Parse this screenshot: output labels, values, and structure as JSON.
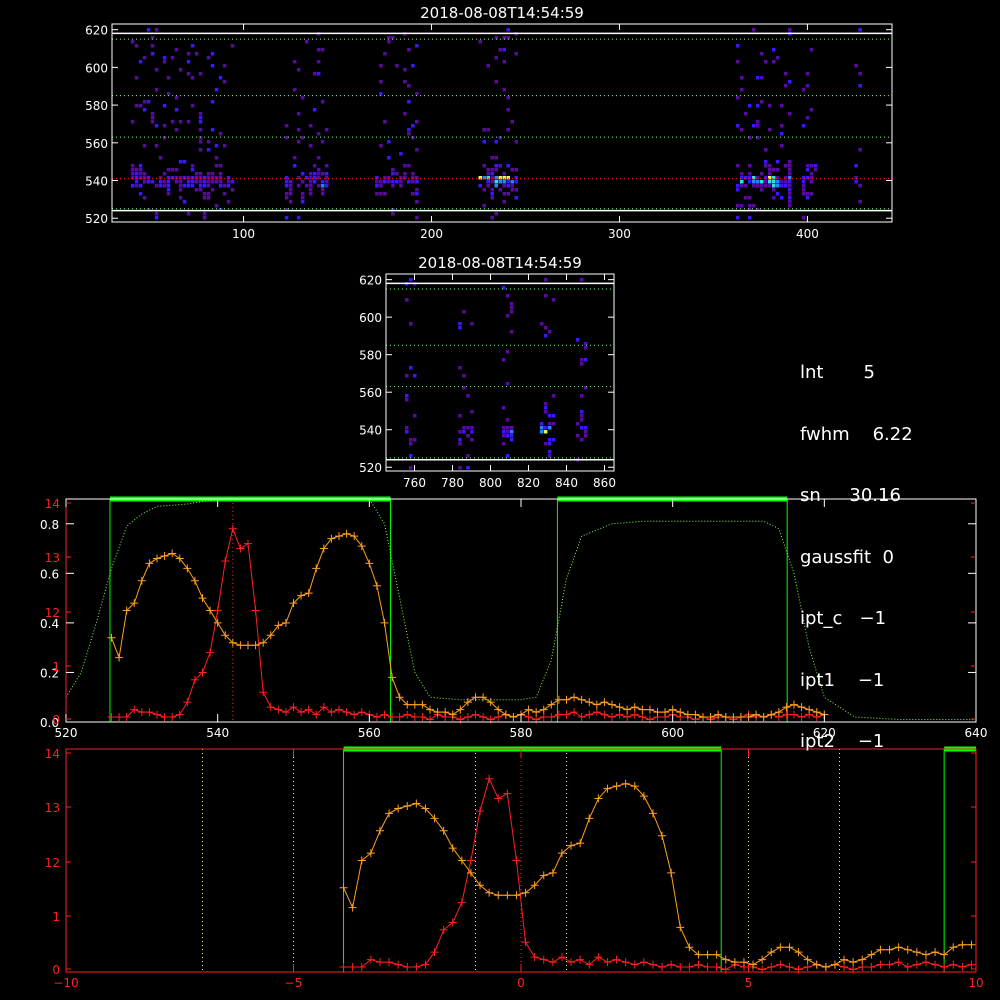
{
  "chart_data": [
    {
      "type": "heatmap",
      "title": "2018-08-08T14:54:59",
      "x_ticks": [
        "100",
        "200",
        "300",
        "400"
      ],
      "y_ticks": [
        "520",
        "540",
        "560",
        "580",
        "600",
        "620"
      ],
      "x_range": [
        30,
        445
      ],
      "y_range": [
        518,
        623
      ],
      "bright_band_y": 541,
      "dotted_lines_y": [
        525,
        541,
        563,
        585,
        615
      ],
      "solid_lines_y": [
        524,
        618
      ],
      "columns": [
        {
          "x": [
            40,
            95
          ],
          "level": 0.55
        },
        {
          "x": [
            122,
            145
          ],
          "level": 0.6
        },
        {
          "x": [
            170,
            193
          ],
          "level": 0.5
        },
        {
          "x": [
            225,
            245
          ],
          "level": 1.0
        },
        {
          "x": [
            362,
            390
          ],
          "level": 0.85
        },
        {
          "x": [
            397,
            405
          ],
          "level": 0.6
        },
        {
          "x": [
            425,
            428
          ],
          "level": 0.4
        }
      ]
    },
    {
      "type": "heatmap",
      "title": "2018-08-08T14:54:59",
      "x_ticks": [
        "760",
        "780",
        "800",
        "820",
        "840",
        "860"
      ],
      "y_ticks": [
        "520",
        "540",
        "560",
        "580",
        "600",
        "620"
      ],
      "x_range": [
        745,
        865
      ],
      "y_range": [
        518,
        623
      ],
      "dotted_lines_y": [
        525,
        563,
        585,
        615
      ],
      "solid_lines_y": [
        524,
        618
      ],
      "columns": [
        {
          "x": [
            755,
            760
          ],
          "level": 0.5
        },
        {
          "x": [
            783,
            790
          ],
          "level": 0.45
        },
        {
          "x": [
            806,
            812
          ],
          "level": 0.6
        },
        {
          "x": [
            826,
            834
          ],
          "level": 1.0
        },
        {
          "x": [
            845,
            850
          ],
          "level": 0.4
        }
      ]
    },
    {
      "type": "line",
      "x_ticks": [
        "520",
        "540",
        "560",
        "580",
        "600",
        "620",
        "640"
      ],
      "y_ticks_left": [
        "0.0",
        "0.2",
        "0.4",
        "0.6",
        "0.8"
      ],
      "y_ticks_red": [
        "0",
        "1",
        "12",
        "13",
        "14"
      ],
      "xlim": [
        520,
        640
      ],
      "ylim": [
        0,
        0.9
      ],
      "marker_line_x": 542,
      "green_bars": [
        [
          525.8,
          562.8
        ],
        [
          584.8,
          615.1
        ]
      ],
      "series": [
        {
          "color": "#ff2020",
          "x": [
            526,
            527,
            528,
            529,
            530,
            531,
            532,
            533,
            534,
            535,
            536,
            537,
            538,
            539,
            540,
            541,
            542,
            543,
            544,
            545,
            546,
            547,
            548,
            549,
            550,
            551,
            552,
            553,
            554,
            555,
            556,
            557,
            558,
            559,
            560,
            561,
            562,
            563,
            564,
            565,
            566,
            567,
            568,
            569,
            570,
            571,
            572,
            573,
            574,
            575,
            576,
            577,
            578,
            579,
            580,
            581,
            582,
            583,
            584,
            585,
            586,
            587,
            588,
            589,
            590,
            591,
            592,
            593,
            594,
            595,
            596,
            597,
            598,
            599,
            600,
            601,
            602,
            603,
            604,
            605,
            606,
            607,
            608,
            609,
            610,
            611,
            612,
            613,
            614,
            615,
            616,
            617,
            618,
            619,
            620
          ],
          "y": [
            0.02,
            0.02,
            0.02,
            0.05,
            0.04,
            0.04,
            0.03,
            0.02,
            0.02,
            0.03,
            0.08,
            0.17,
            0.2,
            0.28,
            0.45,
            0.65,
            0.78,
            0.7,
            0.72,
            0.45,
            0.12,
            0.06,
            0.05,
            0.04,
            0.06,
            0.04,
            0.05,
            0.03,
            0.06,
            0.04,
            0.05,
            0.04,
            0.03,
            0.04,
            0.03,
            0.02,
            0.03,
            0.02,
            0.02,
            0.03,
            0.02,
            0.02,
            0.01,
            0.03,
            0.02,
            0.02,
            0.01,
            0.02,
            0.03,
            0.02,
            0.01,
            0.02,
            0.03,
            0.02,
            0.03,
            0.02,
            0.01,
            0.02,
            0.02,
            0.03,
            0.03,
            0.04,
            0.02,
            0.03,
            0.04,
            0.03,
            0.02,
            0.03,
            0.02,
            0.03,
            0.02,
            0.01,
            0.02,
            0.02,
            0.03,
            0.02,
            0.02,
            0.01,
            0.02,
            0.01,
            0.02,
            0.02,
            0.01,
            0.02,
            0.03,
            0.02,
            0.02,
            0.03,
            0.02,
            0.03,
            0.03,
            0.02,
            0.03,
            0.02,
            0.03
          ]
        },
        {
          "color": "#ffa020",
          "x": [
            526,
            527,
            528,
            529,
            530,
            531,
            532,
            533,
            534,
            535,
            536,
            537,
            538,
            539,
            540,
            541,
            542,
            543,
            544,
            545,
            546,
            547,
            548,
            549,
            550,
            551,
            552,
            553,
            554,
            555,
            556,
            557,
            558,
            559,
            560,
            561,
            562,
            563,
            564,
            565,
            566,
            567,
            568,
            569,
            570,
            571,
            572,
            573,
            574,
            575,
            576,
            577,
            578,
            579,
            580,
            581,
            582,
            583,
            584,
            585,
            586,
            587,
            588,
            589,
            590,
            591,
            592,
            593,
            594,
            595,
            596,
            597,
            598,
            599,
            600,
            601,
            602,
            603,
            604,
            605,
            606,
            607,
            608,
            609,
            610,
            611,
            612,
            613,
            614,
            615,
            616,
            617,
            618,
            619,
            620
          ],
          "y": [
            0.34,
            0.26,
            0.45,
            0.48,
            0.57,
            0.64,
            0.66,
            0.67,
            0.68,
            0.66,
            0.62,
            0.57,
            0.5,
            0.45,
            0.4,
            0.35,
            0.32,
            0.31,
            0.31,
            0.31,
            0.32,
            0.35,
            0.39,
            0.4,
            0.48,
            0.51,
            0.52,
            0.62,
            0.7,
            0.74,
            0.75,
            0.76,
            0.75,
            0.71,
            0.64,
            0.55,
            0.4,
            0.18,
            0.1,
            0.07,
            0.07,
            0.07,
            0.05,
            0.04,
            0.04,
            0.03,
            0.05,
            0.08,
            0.1,
            0.1,
            0.08,
            0.05,
            0.03,
            0.02,
            0.03,
            0.05,
            0.04,
            0.05,
            0.07,
            0.09,
            0.09,
            0.1,
            0.09,
            0.08,
            0.07,
            0.08,
            0.07,
            0.06,
            0.05,
            0.06,
            0.05,
            0.05,
            0.04,
            0.04,
            0.05,
            0.04,
            0.03,
            0.03,
            0.02,
            0.02,
            0.03,
            0.02,
            0.02,
            0.02,
            0.02,
            0.03,
            0.02,
            0.03,
            0.04,
            0.06,
            0.07,
            0.06,
            0.05,
            0.04,
            0.03
          ]
        },
        {
          "color": "#80ff40",
          "dotted": true,
          "x": [
            520,
            522,
            524,
            526,
            528,
            530,
            532,
            536,
            540,
            544,
            548,
            552,
            556,
            560,
            562,
            564,
            566,
            568,
            572,
            576,
            580,
            582,
            584,
            586,
            588,
            592,
            596,
            600,
            604,
            608,
            612,
            614,
            616,
            618,
            620,
            624,
            630,
            636,
            640
          ],
          "y": [
            0.1,
            0.2,
            0.4,
            0.62,
            0.79,
            0.84,
            0.87,
            0.88,
            0.9,
            0.91,
            0.9,
            0.91,
            0.91,
            0.9,
            0.8,
            0.5,
            0.2,
            0.1,
            0.09,
            0.09,
            0.09,
            0.1,
            0.25,
            0.58,
            0.75,
            0.8,
            0.81,
            0.81,
            0.81,
            0.81,
            0.81,
            0.78,
            0.6,
            0.3,
            0.1,
            0.02,
            0.01,
            0.01,
            0.01
          ]
        }
      ]
    },
    {
      "type": "line",
      "x_ticks": [
        "−10",
        "−5",
        "0",
        "5",
        "10"
      ],
      "y_ticks_red": [
        "0",
        "1",
        "12",
        "13",
        "14"
      ],
      "xlim": [
        -10,
        10
      ],
      "ylim": [
        0,
        0.9
      ],
      "marker_line_x": 0,
      "dotted_lines_x": [
        -7,
        -5,
        -1,
        1,
        5,
        7
      ],
      "green_bars": [
        [
          -3.9,
          4.4
        ],
        [
          9.3,
          10
        ]
      ],
      "series": [
        {
          "color": "#ff2020",
          "x": [
            -3.9,
            -3.7,
            -3.5,
            -3.3,
            -3.1,
            -2.9,
            -2.7,
            -2.5,
            -2.3,
            -2.1,
            -1.9,
            -1.7,
            -1.5,
            -1.3,
            -1.1,
            -0.9,
            -0.7,
            -0.5,
            -0.3,
            -0.1,
            0.1,
            0.3,
            0.5,
            0.7,
            0.9,
            1.1,
            1.3,
            1.5,
            1.7,
            1.9,
            2.1,
            2.3,
            2.5,
            2.7,
            2.9,
            3.1,
            3.3,
            3.5,
            3.7,
            3.9,
            4.1,
            4.3,
            4.5,
            4.7,
            4.9,
            5.1,
            5.3,
            5.5,
            5.7,
            5.9,
            6.1,
            6.3,
            6.5,
            6.7,
            6.9,
            7.1,
            7.3,
            7.5,
            7.7,
            7.9,
            8.1,
            8.3,
            8.5,
            8.7,
            8.9,
            9.1,
            9.3,
            9.5,
            9.7,
            9.9
          ],
          "y": [
            0.02,
            0.02,
            0.02,
            0.05,
            0.04,
            0.04,
            0.03,
            0.02,
            0.02,
            0.03,
            0.08,
            0.17,
            0.2,
            0.28,
            0.45,
            0.65,
            0.78,
            0.7,
            0.72,
            0.45,
            0.12,
            0.06,
            0.05,
            0.04,
            0.06,
            0.04,
            0.05,
            0.03,
            0.06,
            0.04,
            0.05,
            0.04,
            0.03,
            0.04,
            0.03,
            0.02,
            0.03,
            0.02,
            0.02,
            0.03,
            0.02,
            0.02,
            0.01,
            0.03,
            0.02,
            0.02,
            0.01,
            0.02,
            0.03,
            0.02,
            0.01,
            0.02,
            0.03,
            0.02,
            0.03,
            0.02,
            0.01,
            0.02,
            0.02,
            0.03,
            0.03,
            0.04,
            0.02,
            0.03,
            0.04,
            0.03,
            0.02,
            0.03,
            0.02,
            0.03
          ]
        },
        {
          "color": "#ffa020",
          "x": [
            -3.9,
            -3.7,
            -3.5,
            -3.3,
            -3.1,
            -2.9,
            -2.7,
            -2.5,
            -2.3,
            -2.1,
            -1.9,
            -1.7,
            -1.5,
            -1.3,
            -1.1,
            -0.9,
            -0.7,
            -0.5,
            -0.3,
            -0.1,
            0.1,
            0.3,
            0.5,
            0.7,
            0.9,
            1.1,
            1.3,
            1.5,
            1.7,
            1.9,
            2.1,
            2.3,
            2.5,
            2.7,
            2.9,
            3.1,
            3.3,
            3.5,
            3.7,
            3.9,
            4.1,
            4.3,
            4.5,
            4.7,
            4.9,
            5.1,
            5.3,
            5.5,
            5.7,
            5.9,
            6.1,
            6.3,
            6.5,
            6.7,
            6.9,
            7.1,
            7.3,
            7.5,
            7.7,
            7.9,
            8.1,
            8.3,
            8.5,
            8.7,
            8.9,
            9.1,
            9.3,
            9.5,
            9.7,
            9.9
          ],
          "y": [
            0.34,
            0.26,
            0.45,
            0.48,
            0.57,
            0.64,
            0.66,
            0.67,
            0.68,
            0.66,
            0.62,
            0.57,
            0.5,
            0.45,
            0.4,
            0.35,
            0.32,
            0.31,
            0.31,
            0.31,
            0.32,
            0.35,
            0.39,
            0.4,
            0.48,
            0.51,
            0.52,
            0.62,
            0.7,
            0.74,
            0.75,
            0.76,
            0.75,
            0.71,
            0.64,
            0.55,
            0.4,
            0.18,
            0.1,
            0.07,
            0.07,
            0.07,
            0.05,
            0.04,
            0.04,
            0.03,
            0.05,
            0.08,
            0.1,
            0.1,
            0.08,
            0.05,
            0.03,
            0.02,
            0.03,
            0.05,
            0.04,
            0.05,
            0.07,
            0.09,
            0.09,
            0.1,
            0.09,
            0.08,
            0.07,
            0.08,
            0.07,
            0.1,
            0.11,
            0.11
          ]
        }
      ]
    }
  ],
  "info": {
    "lines": [
      "lnt       5",
      "fwhm    6.22",
      "sn     30.16",
      "gaussfit  0",
      "ipt_c   −1",
      "ipt1    −1",
      "ipt2    −1"
    ]
  },
  "colors": {
    "axis": "#ffffff",
    "red_axis": "#ff2020",
    "green": "#00ff00",
    "orange": "#ffa020"
  }
}
